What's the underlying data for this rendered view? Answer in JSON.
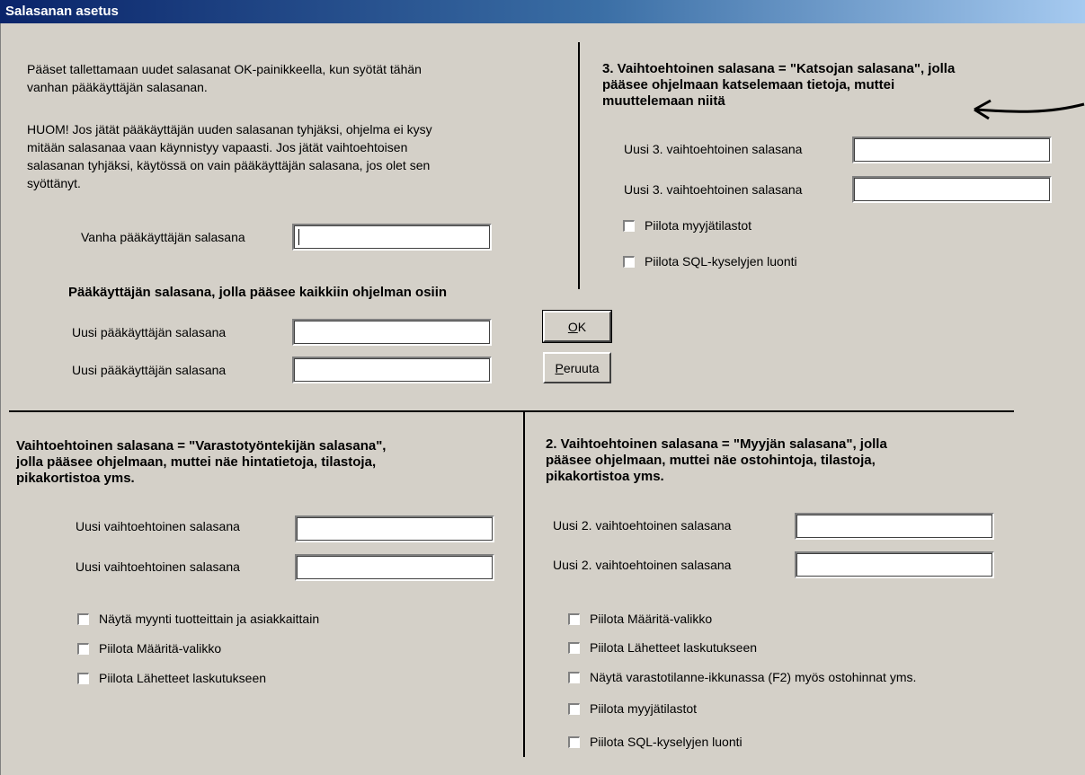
{
  "window": {
    "title": "Salasanan asetus"
  },
  "intro": {
    "line1": "Pääset tallettamaan uudet salasanat OK-painikkeella, kun syötät tähän",
    "line2": "vanhan pääkäyttäjän salasanan.",
    "warn1": "HUOM! Jos jätät pääkäyttäjän uuden salasanan tyhjäksi, ohjelma ei kysy",
    "warn2": "mitään salasanaa vaan käynnistyy vapaasti. Jos jätät vaihtoehtoisen",
    "warn3": "salasanan tyhjäksi, käytössä on vain pääkäyttäjän salasana, jos olet sen",
    "warn4": "syöttänyt."
  },
  "old_admin": {
    "label": "Vanha pääkäyttäjän salasana",
    "value": ""
  },
  "admin": {
    "heading": "Pääkäyttäjän salasana, jolla pääsee kaikkiin ohjelman osiin",
    "new1_label": "Uusi pääkäyttäjän salasana",
    "new2_label": "Uusi pääkäyttäjän salasana"
  },
  "buttons": {
    "ok_mnemonic": "O",
    "ok_rest": "K",
    "cancel_mnemonic": "P",
    "cancel_rest": "eruuta"
  },
  "viewer": {
    "heading1": "3. Vaihtoehtoinen salasana = \"Katsojan salasana\", jolla",
    "heading2": "pääsee ohjelmaan katselemaan tietoja, muttei",
    "heading3": "muuttelemaan niitä",
    "new1_label": "Uusi 3. vaihtoehtoinen salasana",
    "new2_label": "Uusi 3. vaihtoehtoinen salasana",
    "checkboxes": [
      "Piilota myyjätilastot",
      "Piilota SQL-kyselyjen luonti"
    ]
  },
  "warehouse": {
    "heading1": "Vaihtoehtoinen salasana = \"Varastotyöntekijän salasana\",",
    "heading2": "jolla pääsee ohjelmaan, muttei näe hintatietoja, tilastoja,",
    "heading3": "pikakortistoa yms.",
    "new1_label": "Uusi vaihtoehtoinen salasana",
    "new2_label": "Uusi vaihtoehtoinen salasana",
    "checkboxes": [
      "Näytä myynti tuotteittain ja asiakkaittain",
      "Piilota Määritä-valikko",
      "Piilota Lähetteet laskutukseen"
    ]
  },
  "seller": {
    "heading1": "2. Vaihtoehtoinen salasana = \"Myyjän salasana\", jolla",
    "heading2": "pääsee ohjelmaan, muttei näe ostohintoja, tilastoja,",
    "heading3": "pikakortistoa yms.",
    "new1_label": "Uusi 2. vaihtoehtoinen salasana",
    "new2_label": "Uusi 2. vaihtoehtoinen salasana",
    "checkboxes": [
      "Piilota Määritä-valikko",
      "Piilota Lähetteet laskutukseen",
      "Näytä varastotilanne-ikkunassa (F2) myös ostohinnat yms.",
      "Piilota myyjätilastot",
      "Piilota SQL-kyselyjen luonti"
    ]
  }
}
